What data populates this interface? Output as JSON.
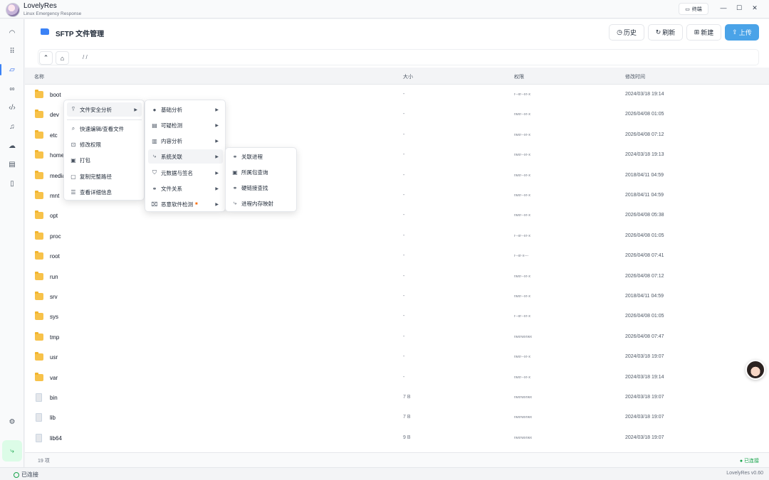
{
  "app": {
    "name": "LovelyRes",
    "subtitle": "Linux Emergency Response",
    "terminal_label": "终端",
    "win_min": "—",
    "win_max": "☐",
    "win_close": "✕"
  },
  "header": {
    "title": "SFTP 文件管理",
    "buttons": {
      "history": "历史",
      "refresh": "刷新",
      "new": "新建",
      "upload": "上传"
    }
  },
  "path": {
    "text": "/ /"
  },
  "table": {
    "columns": {
      "name": "名称",
      "size": "大小",
      "perm": "权限",
      "mtime": "修改时间"
    },
    "rows": [
      {
        "name": "boot",
        "type": "dir",
        "size": "-",
        "perm": "r--xr--xr-x",
        "mtime": "2024/03/18 19:14"
      },
      {
        "name": "dev",
        "type": "dir",
        "size": "-",
        "perm": "rwxr--xr-x",
        "mtime": "2026/04/08 01:05"
      },
      {
        "name": "etc",
        "type": "dir",
        "size": "-",
        "perm": "rwxr--xr-x",
        "mtime": "2026/04/08 07:12"
      },
      {
        "name": "home",
        "type": "dir",
        "size": "-",
        "perm": "rwxr--xr-x",
        "mtime": "2024/03/18 19:13"
      },
      {
        "name": "media",
        "type": "dir",
        "size": "-",
        "perm": "rwxr--xr-x",
        "mtime": "2018/04/11 04:59"
      },
      {
        "name": "mnt",
        "type": "dir",
        "size": "-",
        "perm": "rwxr--xr-x",
        "mtime": "2018/04/11 04:59"
      },
      {
        "name": "opt",
        "type": "dir",
        "size": "-",
        "perm": "rwxr--xr-x",
        "mtime": "2026/04/08 05:38"
      },
      {
        "name": "proc",
        "type": "dir",
        "size": "-",
        "perm": "r--xr--xr-x",
        "mtime": "2026/04/08 01:05"
      },
      {
        "name": "root",
        "type": "dir",
        "size": "-",
        "perm": "r--xr-x---",
        "mtime": "2026/04/08 07:41"
      },
      {
        "name": "run",
        "type": "dir",
        "size": "-",
        "perm": "rwxr--xr-x",
        "mtime": "2026/04/08 07:12"
      },
      {
        "name": "srv",
        "type": "dir",
        "size": "-",
        "perm": "rwxr--xr-x",
        "mtime": "2018/04/11 04:59"
      },
      {
        "name": "sys",
        "type": "dir",
        "size": "-",
        "perm": "r--xr--xr-x",
        "mtime": "2026/04/08 01:05"
      },
      {
        "name": "tmp",
        "type": "dir",
        "size": "-",
        "perm": "rwxrwxrwx",
        "mtime": "2026/04/08 07:47"
      },
      {
        "name": "usr",
        "type": "dir",
        "size": "-",
        "perm": "rwxr--xr-x",
        "mtime": "2024/03/18 19:07"
      },
      {
        "name": "var",
        "type": "dir",
        "size": "-",
        "perm": "rwxr--xr-x",
        "mtime": "2024/03/18 19:14"
      },
      {
        "name": "bin",
        "type": "file",
        "size": "7 B",
        "perm": "rwxrwxrwx",
        "mtime": "2024/03/18 19:07"
      },
      {
        "name": "lib",
        "type": "file",
        "size": "7 B",
        "perm": "rwxrwxrwx",
        "mtime": "2024/03/18 19:07"
      },
      {
        "name": "lib64",
        "type": "file",
        "size": "9 B",
        "perm": "rwxrwxrwx",
        "mtime": "2024/03/18 19:07"
      }
    ]
  },
  "footer": {
    "count": "19 项",
    "connection": "● 已连接"
  },
  "status": {
    "left": "已连接",
    "right": "LovelyRes v0.60"
  },
  "menu1": {
    "items": [
      "文件安全分析",
      "快速编辑/查看文件",
      "修改权限",
      "打包",
      "复制完整路径",
      "查看详细信息"
    ]
  },
  "menu2": {
    "items": [
      "基础分析",
      "可疑检测",
      "内容分析",
      "系统关联",
      "元数据与签名",
      "文件关系",
      "恶意软件检测"
    ]
  },
  "menu3": {
    "items": [
      "关联进程",
      "所属包查询",
      "硬链接查找",
      "进程内存映射"
    ]
  }
}
